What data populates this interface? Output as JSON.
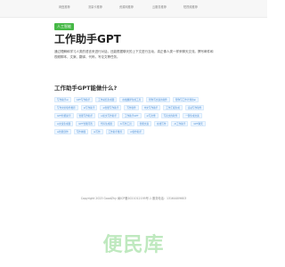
{
  "nav": {
    "items": [
      "网盘推荐",
      "流量卡推荐",
      "资源网推荐",
      "云服务推荐",
      "短视频推荐"
    ]
  },
  "hero": {
    "badge": "人工智能",
    "title": "工作助手GPT",
    "intro": "通过理解和学习人类的语言来进行对话，还能根据聊天的上下文进行互动，真正像人类一样来聊天交流。撰写邮件和视频脚本，文案、翻译、代码，写论文等任务。"
  },
  "section": {
    "title": "工作助手GPT能做什么?"
  },
  "tags": [
    "写作助手ai",
    "GPT写作助手",
    "工作总结生成器",
    "在线翻译生成工具",
    "帮你写文案的软件",
    "帮你写工作计划的ai",
    "写作文的软件推荐",
    "ai写作助手",
    "ai智能写作助手",
    "写作软件",
    "中文写作助手",
    "工作汇报生成",
    "自动写作软件",
    "GPT智能助手",
    "智能写作助手",
    "ai论文写作助手",
    "工作助手GPT",
    "ai写文章",
    "写论文的软件",
    "一键生成文案",
    "ai文案生成器",
    "GPT智能问答",
    "代码生成器",
    "AI写作工具",
    "智能文案",
    "在线写作",
    "AI工作助手",
    "GPT聊天",
    "ai智能创作",
    "写作神器",
    "ai写作",
    "工作助手推荐",
    "AI创作助手"
  ],
  "footer": {
    "text": "Copyright 2023 GoodZhy 闽ICP备2021012195号-1 服务电话：13164409603"
  },
  "watermark": {
    "text": "便民库"
  }
}
